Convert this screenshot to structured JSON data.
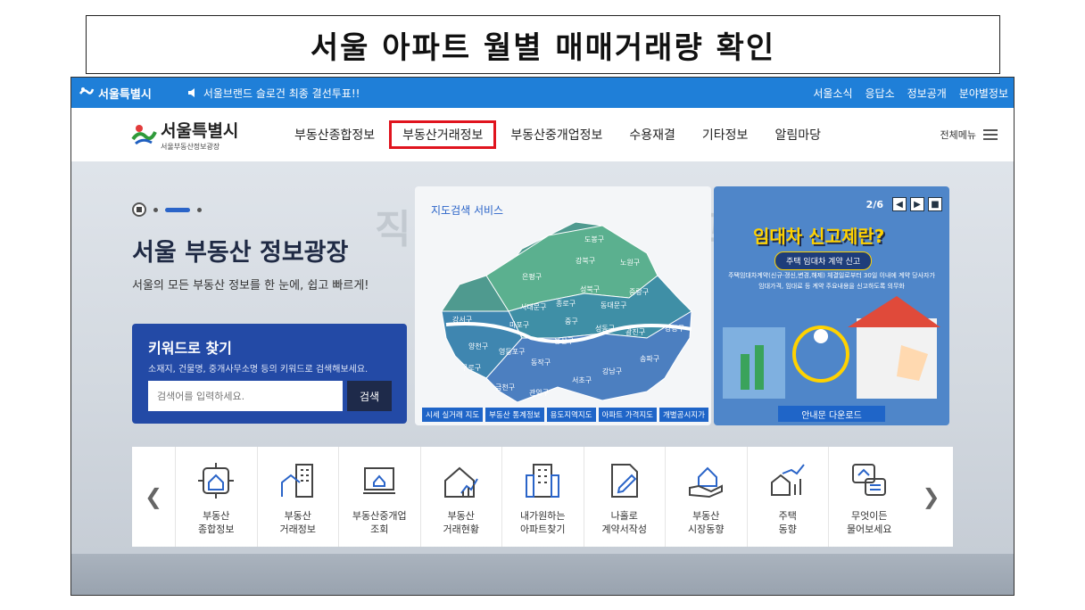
{
  "slide_title": "서울 아파트 월별 매매거래량 확인",
  "topbar": {
    "brand": "서울특별시",
    "notice": "서울브랜드 슬로건 최종 결선투표!!",
    "links": [
      "서울소식",
      "응답소",
      "정보공개",
      "분야별정보"
    ]
  },
  "nav": {
    "logo_main": "서울특별시",
    "logo_sub": "서울부동산정보광장",
    "items": [
      "부동산종합정보",
      "부동산거래정보",
      "부동산중개업정보",
      "수용재결",
      "기타정보",
      "알림마당"
    ],
    "highlighted_index": 1,
    "full_menu": "전체메뉴"
  },
  "hero": {
    "title": "서울 부동산 정보광장",
    "subtitle": "서울의 모든 부동산 정보를 한 눈에, 쉽고 빠르게!",
    "watermark": "직장인 재테크 학교"
  },
  "keyword": {
    "title": "키워드로 찾기",
    "desc": "소재지, 건물명, 중개사무소명 등의 키워드로 검색해보세요.",
    "placeholder": "검색어를 입력하세요.",
    "button": "검색"
  },
  "map": {
    "title": "지도검색 서비스",
    "districts": [
      "도봉구",
      "강북구",
      "노원구",
      "은평구",
      "성북구",
      "중랑구",
      "종로구",
      "동대문구",
      "서대문구",
      "강서구",
      "마포구",
      "중구",
      "성동구",
      "광진구",
      "강동구",
      "용산구",
      "양천구",
      "영등포구",
      "동작구",
      "송파구",
      "구로구",
      "강남구",
      "서초구",
      "금천구",
      "관악구"
    ],
    "tabs": [
      "시세 실거래 지도",
      "부동산 통계정보",
      "용도지역지도",
      "아파트 가격지도",
      "개별공시지가"
    ]
  },
  "promo": {
    "counter": "2/6",
    "title": "임대차 신고제란?",
    "pill": "주택 임대차 계약 신고",
    "text": "주택임대차계약(신규·갱신,변경,해제) 체결일로부터 30일 이내에 계약 당사자가 임대가격, 임대료 등 계약 주요내용을 신고하도록 의무화",
    "download": "안내문 다운로드"
  },
  "quick_links": [
    {
      "l1": "부동산",
      "l2": "종합정보",
      "icon": "house-target-icon"
    },
    {
      "l1": "부동산",
      "l2": "거래정보",
      "icon": "building-icon"
    },
    {
      "l1": "부동산중개업",
      "l2": "조회",
      "icon": "monitor-house-icon"
    },
    {
      "l1": "부동산",
      "l2": "거래현황",
      "icon": "house-chart-icon"
    },
    {
      "l1": "내가원하는",
      "l2": "아파트찾기",
      "icon": "apartment-icon"
    },
    {
      "l1": "나홀로",
      "l2": "계약서작성",
      "icon": "contract-pen-icon"
    },
    {
      "l1": "부동산",
      "l2": "시장동향",
      "icon": "hand-house-icon"
    },
    {
      "l1": "주택",
      "l2": "동향",
      "icon": "house-trend-icon"
    },
    {
      "l1": "무엇이든",
      "l2": "물어보세요",
      "icon": "chat-house-icon"
    }
  ],
  "colors": {
    "topbar": "#1f7fd8",
    "keyword_box": "#234aa6",
    "highlight": "#e0141e",
    "promo": "#4f86c9"
  }
}
